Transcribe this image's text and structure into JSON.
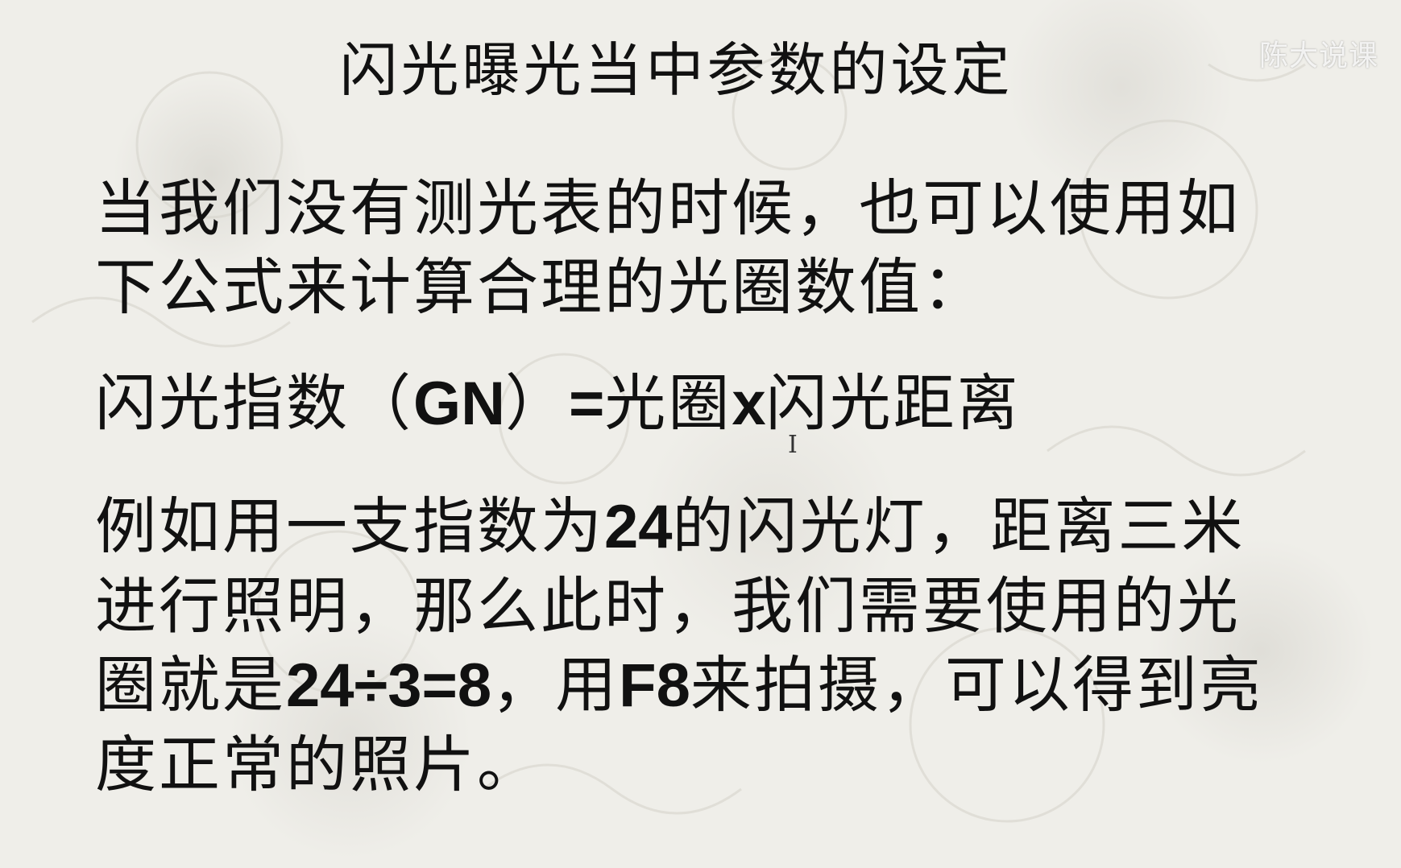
{
  "title": "闪光曝光当中参数的设定",
  "logo_text": "陈大说课",
  "paragraph1": {
    "text": "当我们没有测光表的时候，也可以使用如下公式来计算合理的光圈数值："
  },
  "formula": {
    "prefix": "闪光指数（",
    "gn": "GN",
    "middle": "）",
    "equals": "=",
    "aperture": "光圈",
    "times": "x",
    "distance": "闪光距离"
  },
  "example": {
    "part1": "例如用一支指数为",
    "gn_value": "24",
    "part2": "的闪光灯，距离三米进行照明，那么此时，我们需要使用的光圈就是",
    "calc": "24÷3=8",
    "part3": "，用",
    "f_value": "F8",
    "part4": "来拍摄，可以得到亮度正常的照片。"
  },
  "cursor_glyph": "I"
}
